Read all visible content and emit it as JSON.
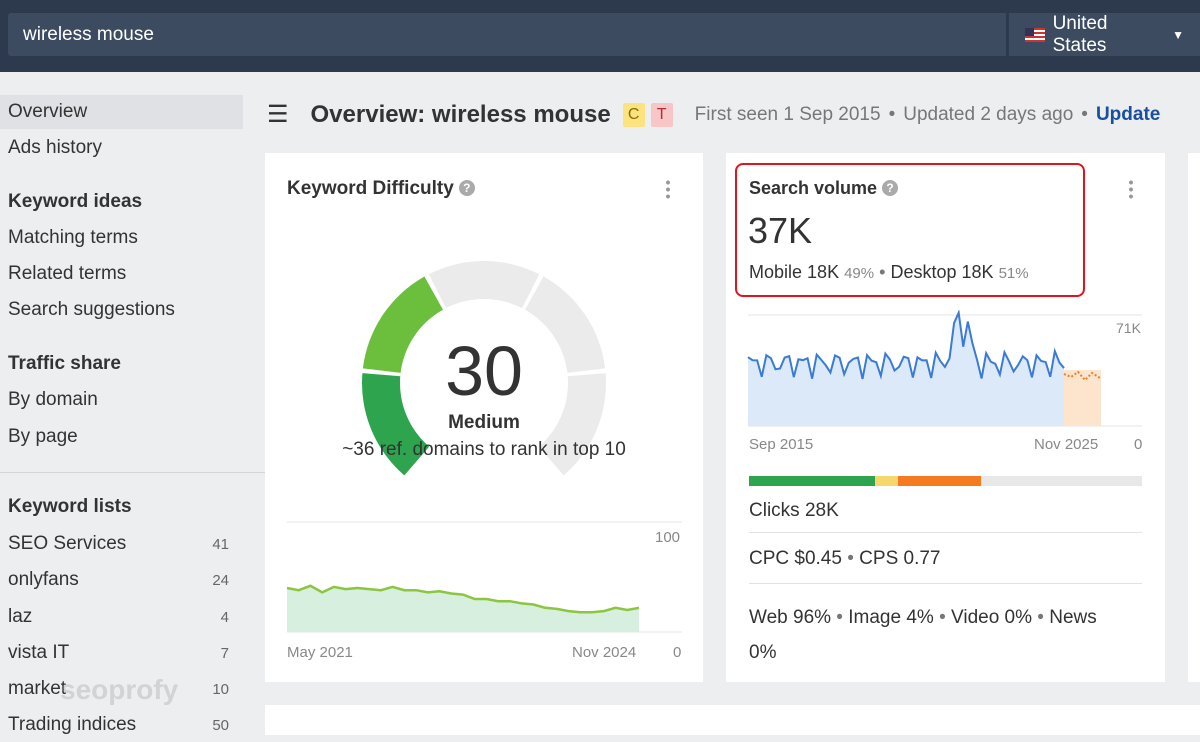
{
  "search": {
    "query": "wireless mouse",
    "country": "United States",
    "country_icon": "us-flag-icon"
  },
  "sidebar": {
    "items": [
      {
        "label": "Overview",
        "active": true
      },
      {
        "label": "Ads history"
      }
    ],
    "sections": [
      {
        "title": "Keyword ideas",
        "items": [
          "Matching terms",
          "Related terms",
          "Search suggestions"
        ]
      },
      {
        "title": "Traffic share",
        "items": [
          "By domain",
          "By page"
        ]
      }
    ],
    "lists_title": "Keyword lists",
    "lists": [
      {
        "label": "SEO Services",
        "count": "41"
      },
      {
        "label": "onlyfans",
        "count": "24"
      },
      {
        "label": "laz",
        "count": "4"
      },
      {
        "label": "vista IT",
        "count": "7"
      },
      {
        "label": "market",
        "count": "10"
      },
      {
        "label": "Trading indices",
        "count": "50"
      }
    ]
  },
  "header": {
    "title": "Overview: wireless mouse",
    "badges": [
      "C",
      "T"
    ],
    "first_seen": "First seen 1 Sep 2015",
    "sep": "•",
    "updated": "Updated 2 days ago",
    "update_link": "Update"
  },
  "kd": {
    "title": "Keyword Difficulty",
    "help": "?",
    "value": "30",
    "level": "Medium",
    "subtitle": "~36 ref. domains to rank in top 10",
    "level_fraction": 0.3,
    "trend": {
      "ymax": "100",
      "ymin": "0",
      "x_start": "May 2021",
      "x_end": "Nov 2024",
      "values": [
        40,
        38,
        42,
        36,
        41,
        39,
        40,
        39,
        38,
        41,
        38,
        38,
        36,
        37,
        35,
        34,
        30,
        30,
        28,
        28,
        26,
        25,
        22,
        21,
        19,
        18,
        18,
        19,
        22,
        20,
        22
      ]
    }
  },
  "sv": {
    "title": "Search volume",
    "help": "?",
    "value": "37K",
    "mobile_label": "Mobile",
    "mobile": "18K",
    "mobile_pct": "49%",
    "desktop_label": "Desktop",
    "desktop": "18K",
    "desktop_pct": "51%",
    "trend": {
      "ymax": "71K",
      "ymin": "0",
      "x_start": "Sep 2015",
      "x_end": "Nov 2025"
    },
    "clicks": "Clicks 28K",
    "cpc": "CPC $0.45",
    "cps": "CPS 0.77",
    "serp": [
      "Web 96%",
      "Image 4%",
      "Video 0%",
      "News 0%"
    ],
    "click_bar": [
      {
        "color": "#2ea44f",
        "fraction": 0.32
      },
      {
        "color": "#f5d76e",
        "fraction": 0.06
      },
      {
        "color": "#f47b20",
        "fraction": 0.21
      },
      {
        "color": "#e8e8e8",
        "fraction": 0.41
      }
    ]
  },
  "watermark": "seoprofy"
}
